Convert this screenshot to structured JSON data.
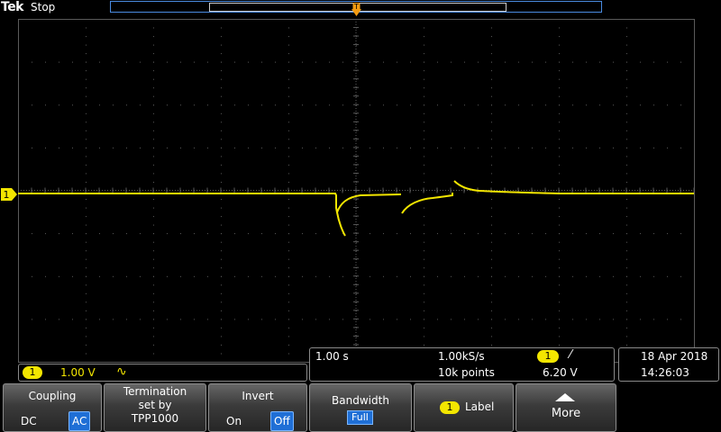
{
  "header": {
    "brand": "Tek",
    "status": "Stop"
  },
  "trigger_position_marker": "T",
  "channel1": {
    "marker": "1",
    "badge": "1",
    "scale": "1.00 V",
    "coupling_symbol": "∿",
    "trace_color": "#f3e600"
  },
  "timebase": {
    "scale": "1.00 s",
    "sample_rate": "1.00kS/s",
    "record_length": "10k points",
    "trigger_source": "1",
    "trigger_slope": "⁄",
    "trigger_level": "6.20 V"
  },
  "datetime": {
    "date": "18 Apr  2018",
    "time": "14:26:03"
  },
  "softkeys": {
    "coupling": {
      "title": "Coupling",
      "opt1": "DC",
      "opt2": "AC"
    },
    "termination": {
      "line1": "Termination",
      "line2": "set by",
      "line3": "TPP1000"
    },
    "invert": {
      "title": "Invert",
      "opt1": "On",
      "opt2": "Off"
    },
    "bandwidth": {
      "title": "Bandwidth",
      "value": "Full"
    },
    "label": {
      "badge": "1",
      "text": "Label"
    },
    "more": {
      "text": "More"
    }
  },
  "colors": {
    "accent": "#1f6fd6",
    "trace": "#f3e600",
    "graticule": "#5a5a5a"
  }
}
